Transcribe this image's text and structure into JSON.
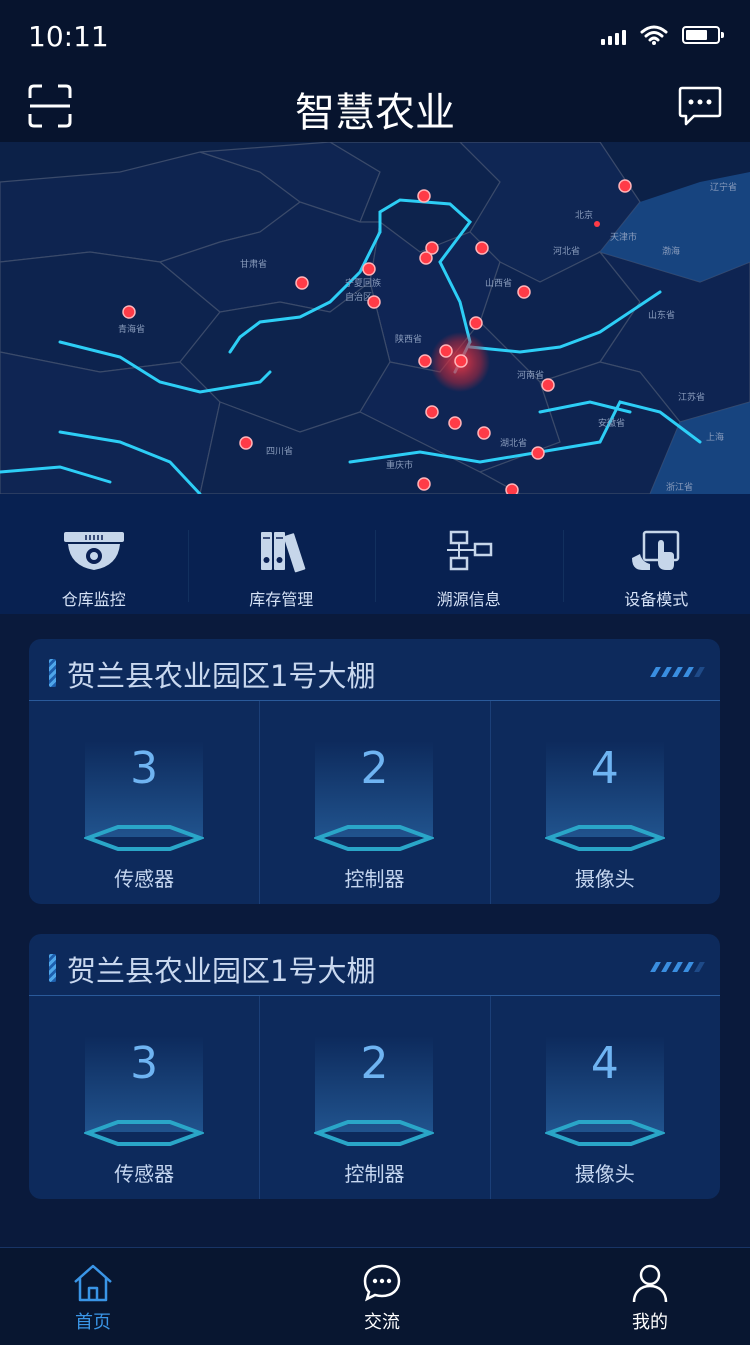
{
  "status_bar": {
    "time": "10:11"
  },
  "header": {
    "title": "智慧农业",
    "scan_icon": "scan-icon",
    "message_icon": "message-icon"
  },
  "map": {
    "labels": [
      "辽宁省",
      "北京",
      "天津市",
      "渤海",
      "河北省",
      "甘肃省",
      "宁夏回族",
      "自治区",
      "山西省",
      "山东省",
      "青海省",
      "陕西省",
      "河南省",
      "江苏省",
      "安徽省",
      "湖北省",
      "四川省",
      "重庆市",
      "浙江省",
      "上海"
    ]
  },
  "quick_menu": [
    {
      "label": "仓库监控",
      "icon": "camera-icon"
    },
    {
      "label": "库存管理",
      "icon": "binders-icon"
    },
    {
      "label": "溯源信息",
      "icon": "network-icon"
    },
    {
      "label": "设备模式",
      "icon": "touchscreen-icon"
    }
  ],
  "cards": [
    {
      "title": "贺兰县农业园区1号大棚",
      "stats": [
        {
          "value": "3",
          "label": "传感器"
        },
        {
          "value": "2",
          "label": "控制器"
        },
        {
          "value": "4",
          "label": "摄像头"
        }
      ]
    },
    {
      "title": "贺兰县农业园区1号大棚",
      "stats": [
        {
          "value": "3",
          "label": "传感器"
        },
        {
          "value": "2",
          "label": "控制器"
        },
        {
          "value": "4",
          "label": "摄像头"
        }
      ]
    }
  ],
  "tab_bar": [
    {
      "label": "首页",
      "icon": "home-icon",
      "active": true
    },
    {
      "label": "交流",
      "icon": "chat-icon",
      "active": false
    },
    {
      "label": "我的",
      "icon": "user-icon",
      "active": false
    }
  ],
  "colors": {
    "accent": "#3a95e6",
    "background": "#0a1a3c",
    "card": "#0d2a5c",
    "marker": "#ff3b47",
    "river": "#2fd8ff"
  }
}
